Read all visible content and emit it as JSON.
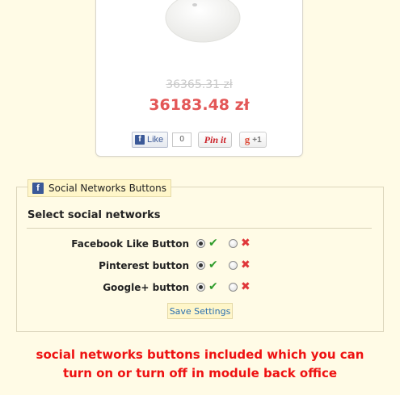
{
  "product": {
    "old_price": "36365.31 zł",
    "new_price": "36183.48 zł",
    "image_icon": "mouse-image"
  },
  "social_preview": {
    "facebook_like_label": "Like",
    "facebook_like_count": "0",
    "pinterest_label": "Pin it",
    "google_plus_label": "+1"
  },
  "module": {
    "legend": "Social Networks Buttons",
    "section_title": "Select social networks",
    "networks": [
      {
        "label": "Facebook Like Button",
        "enabled": true
      },
      {
        "label": "Pinterest button",
        "enabled": true
      },
      {
        "label": "Google+ button",
        "enabled": true
      }
    ],
    "save_label": "Save Settings"
  },
  "caption": {
    "line1": "social networks buttons included which you can",
    "line2": "turn on or turn off in module back office"
  },
  "colors": {
    "page_bg": "#fffbe6",
    "price_red": "#e35656",
    "caption_red": "#ee1111",
    "check_green": "#2f9c2c",
    "cross_red": "#e0373a",
    "facebook_blue": "#3b5998"
  }
}
